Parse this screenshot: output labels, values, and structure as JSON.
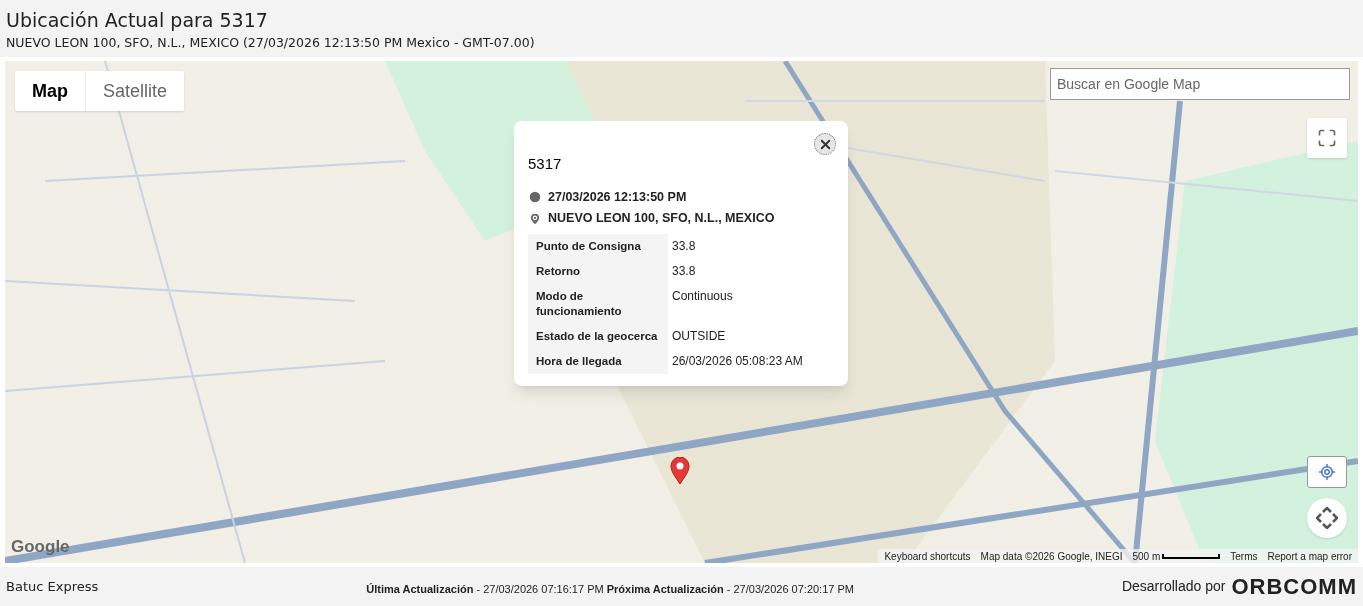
{
  "header": {
    "title": "Ubicación Actual para 5317",
    "subtitle": "NUEVO LEON 100, SFO, N.L., MEXICO (27/03/2026 12:13:50 PM Mexico - GMT-07.00)"
  },
  "map": {
    "type_tabs": [
      {
        "label": "Map",
        "selected": true
      },
      {
        "label": "Satellite",
        "selected": false
      }
    ],
    "search": {
      "placeholder": "Buscar en Google Map"
    },
    "info_window": {
      "title": "5317",
      "time": "27/03/2026 12:13:50 PM",
      "address": "NUEVO LEON 100, SFO, N.L., MEXICO",
      "rows": [
        {
          "label": "Punto de Consigna",
          "value": "33.8"
        },
        {
          "label": "Retorno",
          "value": "33.8"
        },
        {
          "label": "Modo de funcionamiento",
          "value": "Continuous"
        },
        {
          "label": "Estado de la geocerca",
          "value": "OUTSIDE"
        },
        {
          "label": "Hora de llegada",
          "value": "26/03/2026 05:08:23 AM"
        }
      ]
    },
    "logo": "Google",
    "attribution": {
      "shortcuts": "Keyboard shortcuts",
      "data": "Map data ©2026 Google, INEGI",
      "scale": "500 m",
      "terms": "Terms",
      "report": "Report a map error"
    }
  },
  "footer": {
    "company": "Batuc Express",
    "updates": "**Última Actualización** - 27/03/2026 07:16:17 PM **Próxima Actualización** - 27/03/2026 07:20:17 PM",
    "developed_by": "Desarrollado por",
    "brand": "ORBCOMM"
  }
}
